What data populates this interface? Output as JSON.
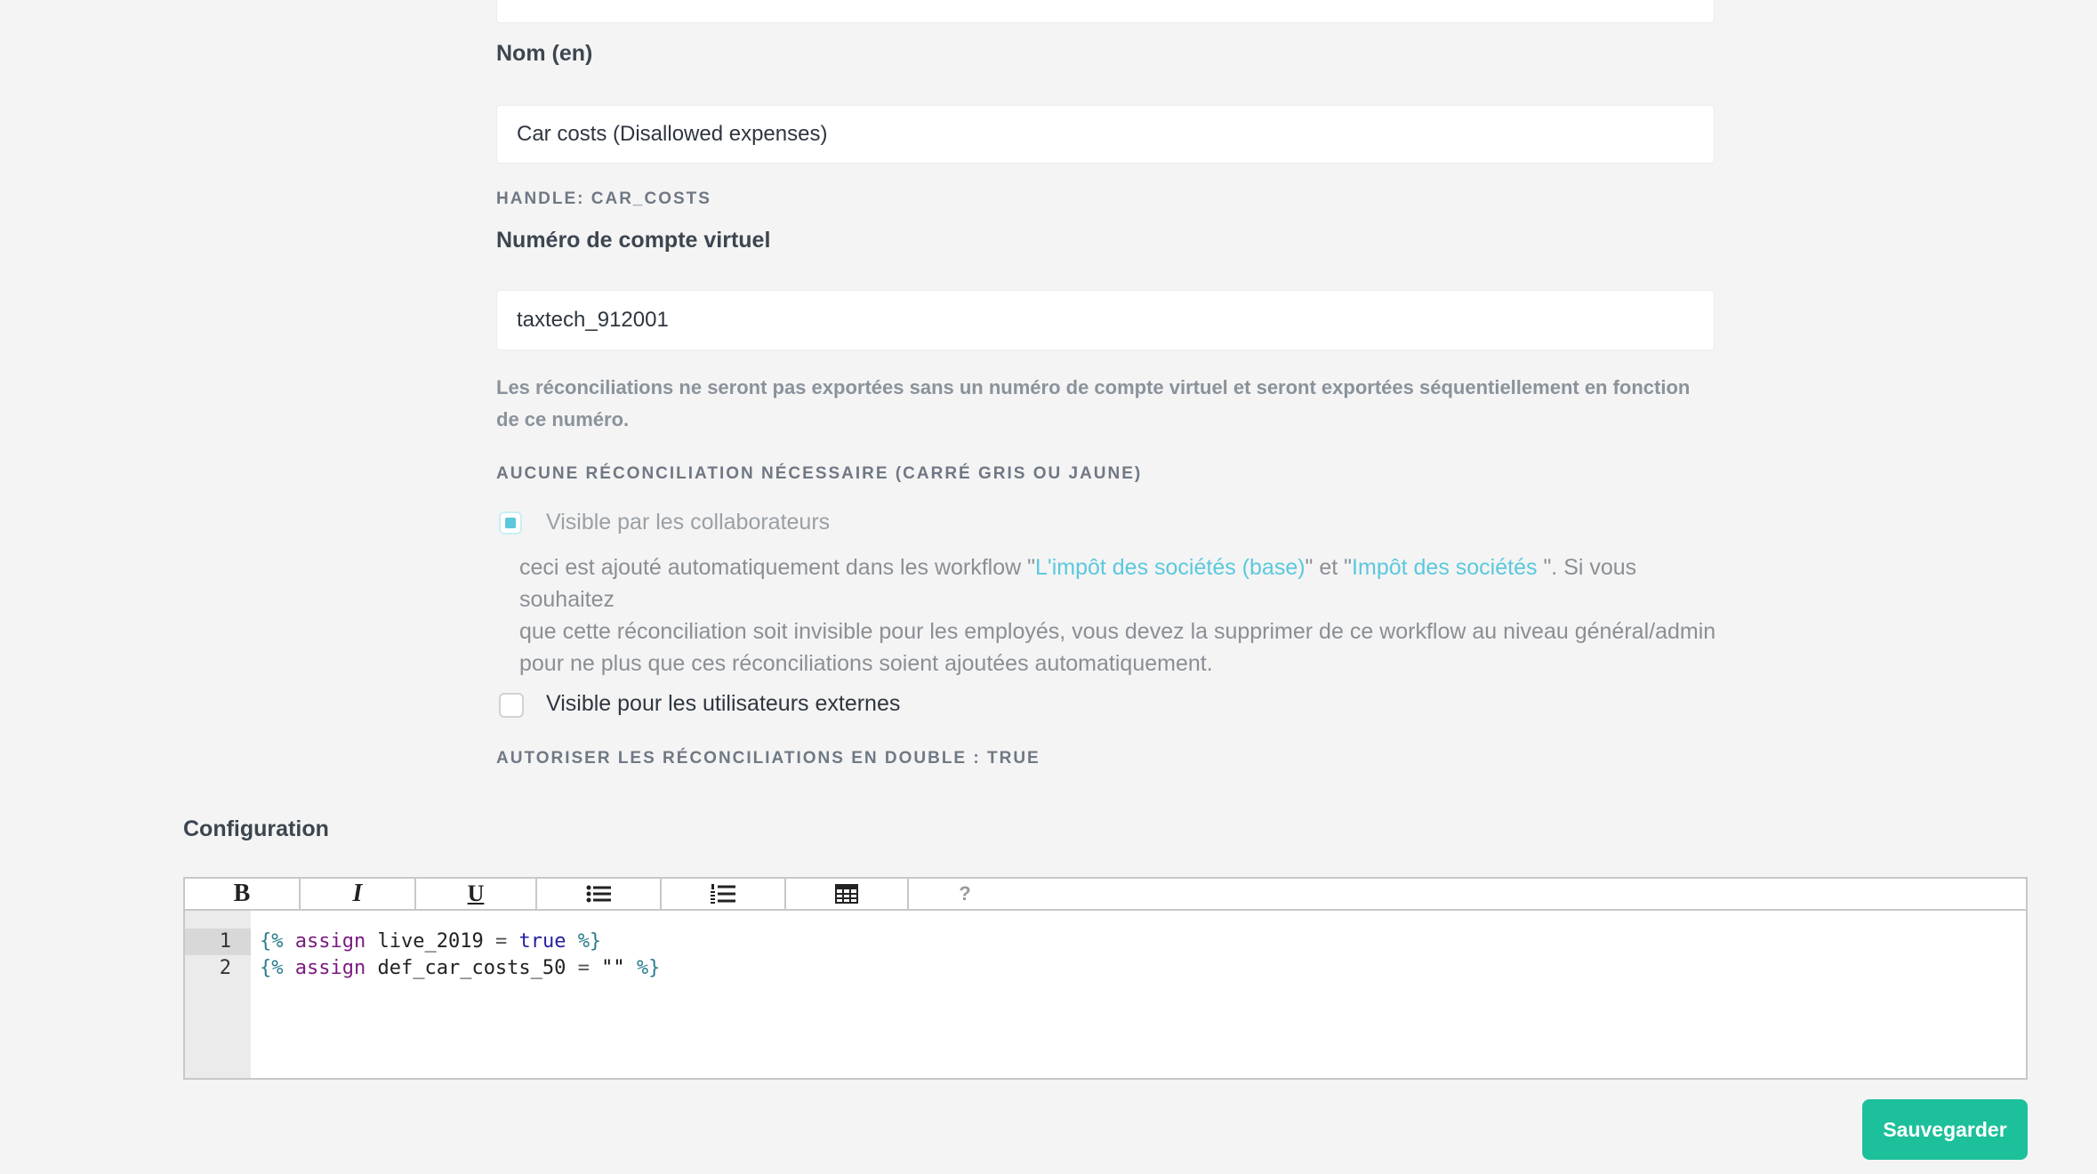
{
  "form": {
    "name_en_label": "Nom (en)",
    "name_en_value": "Car costs (Disallowed expenses)",
    "handle_text": "HANDLE: CAR_COSTS",
    "virtual_account_label": "Numéro de compte virtuel",
    "virtual_account_value": "taxtech_912001",
    "virtual_account_help_line1": "Les réconciliations ne seront pas exportées sans un numéro de compte virtuel et seront exportées séquentiellement en fonction",
    "virtual_account_help_line2": "de ce numéro.",
    "no_reconciliation_heading": "AUCUNE RÉCONCILIATION NÉCESSAIRE (CARRÉ GRIS OU JAUNE)",
    "visible_collaborators": {
      "label": "Visible par les collaborateurs",
      "checked": true
    },
    "description": {
      "line1_pre": "ceci est ajouté automatiquement dans les workflow \"",
      "link1": "L'impôt des sociétés (base)",
      "line1_mid": "\" et \"",
      "link2": "Impôt des sociétés ",
      "line1_post": "\". Si vous souhaitez",
      "line2": "que cette réconciliation soit invisible pour les employés, vous devez la supprimer de ce workflow au niveau général/admin",
      "line3": "pour ne plus que ces réconciliations soient ajoutées automatiquement."
    },
    "visible_external": {
      "label": "Visible pour les utilisateurs externes",
      "checked": false
    },
    "allow_duplicates_text": "AUTORISER LES RÉCONCILIATIONS EN DOUBLE : TRUE"
  },
  "configuration": {
    "label": "Configuration",
    "toolbar": {
      "bold": "B",
      "italic": "I",
      "underline": "U",
      "help": "?"
    },
    "lines": [
      {
        "no": "1",
        "open": "{%",
        "kw": "assign",
        "var": "live_2019",
        "op": "=",
        "val": "true",
        "close": "%}"
      },
      {
        "no": "2",
        "open": "{%",
        "kw": "assign",
        "var": "def_car_costs_50",
        "op": "=",
        "val": "\"\"",
        "close": "%}"
      }
    ]
  },
  "save_button": "Sauvegarder",
  "colors": {
    "accent": "#5bc8dd",
    "save": "#1cc09a",
    "background": "#f4f4f4"
  }
}
